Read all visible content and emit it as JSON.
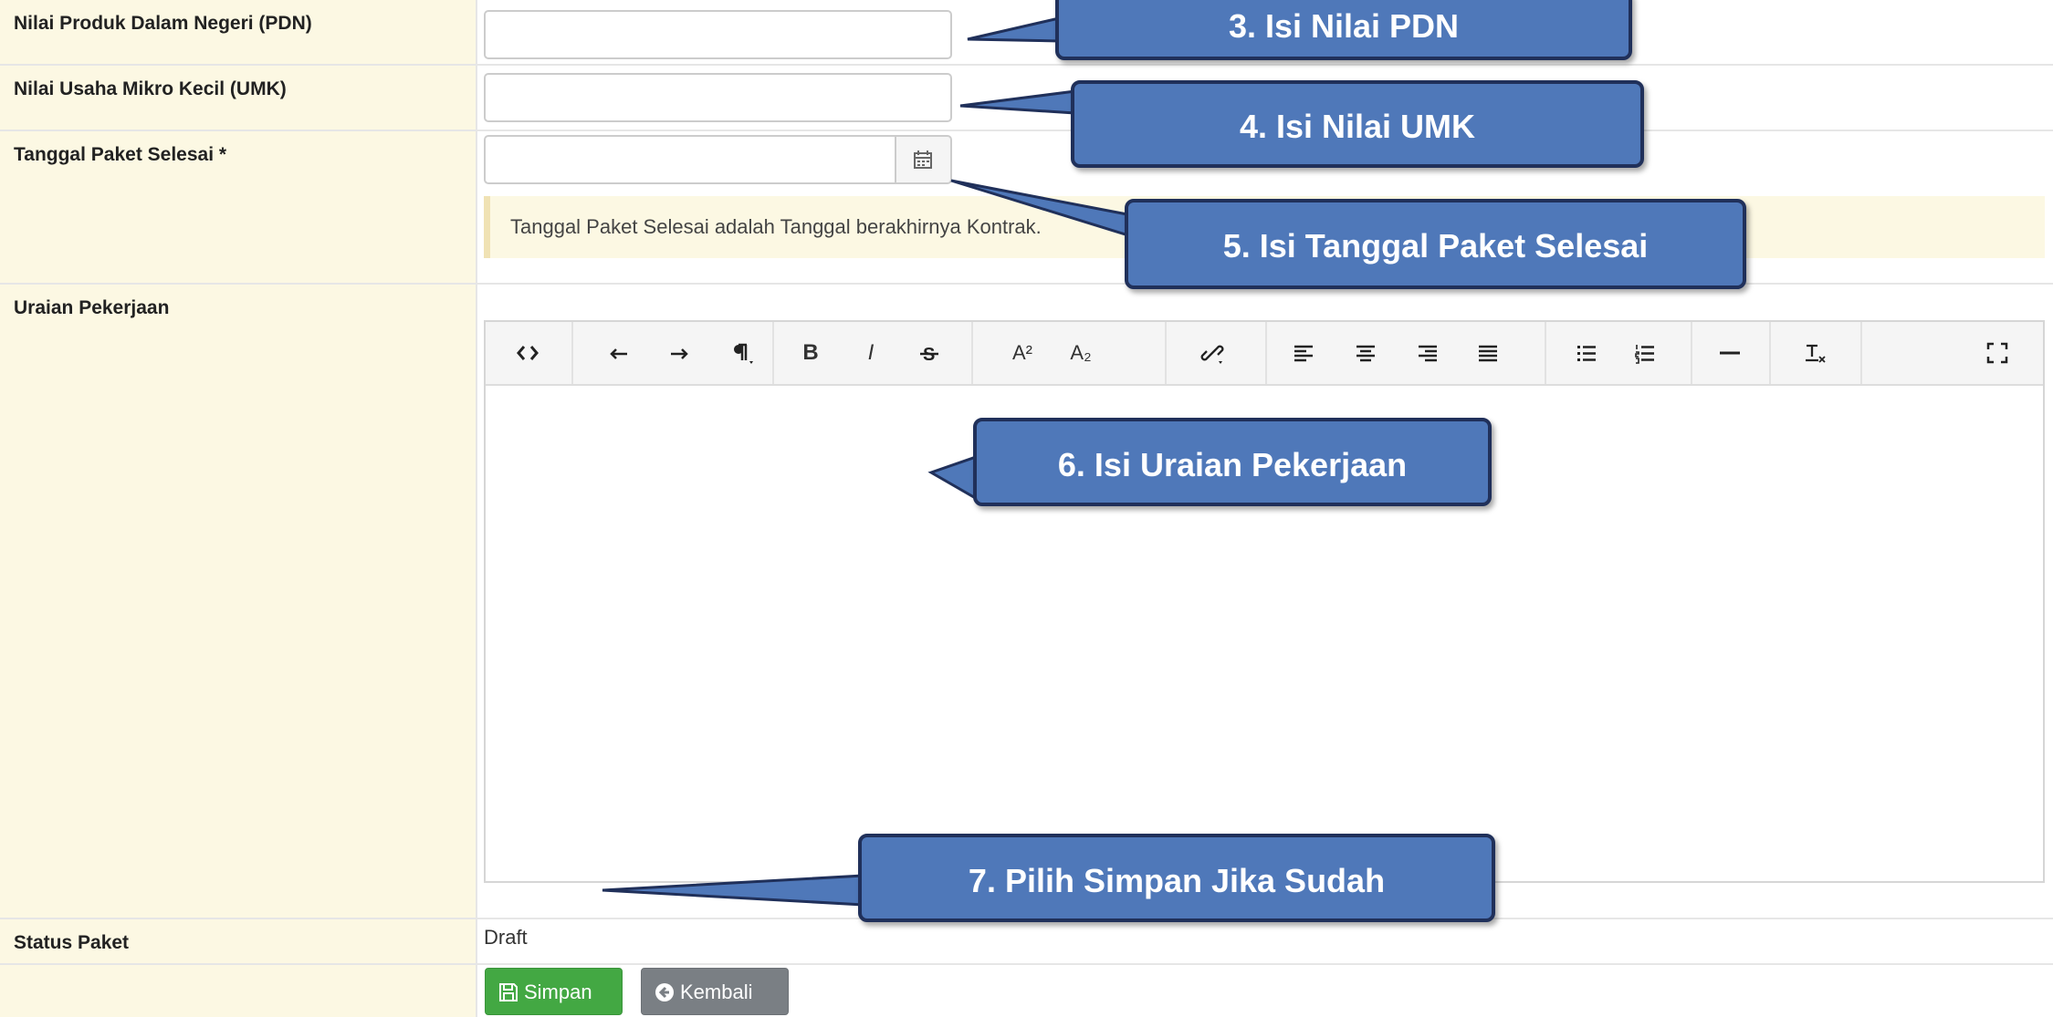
{
  "form": {
    "pdn_label": "Nilai Produk Dalam Negeri (PDN)",
    "umk_label": "Nilai Usaha Mikro Kecil (UMK)",
    "tanggal_label": "Tanggal Paket Selesai",
    "required_mark": "*",
    "tanggal_hint": "Tanggal Paket Selesai adalah Tanggal berakhirnya Kontrak.",
    "uraian_label": "Uraian Pekerjaan",
    "status_label": "Status Paket",
    "status_value": "Draft",
    "save_label": "Simpan",
    "back_label": "Kembali"
  },
  "editor": {
    "toolbar": [
      "code-view-icon",
      "undo-icon",
      "redo-icon",
      "paragraph-format-icon",
      "bold-icon",
      "italic-icon",
      "strikethrough-icon",
      "superscript-icon",
      "subscript-icon",
      "insert-link-icon",
      "align-left-icon",
      "align-center-icon",
      "align-right-icon",
      "align-justify-icon",
      "unordered-list-icon",
      "ordered-list-icon",
      "horizontal-rule-icon",
      "clear-formatting-icon",
      "fullscreen-icon"
    ],
    "bold_glyph": "B",
    "italic_glyph": "I",
    "superscript_glyph": "A²",
    "subscript_glyph": "A₂"
  },
  "callouts": {
    "c3": "3. Isi Nilai PDN",
    "c4": "4. Isi Nilai UMK",
    "c5": "5. Isi Tanggal Paket Selesai",
    "c6": "6. Isi Uraian Pekerjaan",
    "c7": "7. Pilih Simpan Jika Sudah"
  },
  "colors": {
    "label_bg": "#fcf8e3",
    "callout_bg": "#4f78b9",
    "save_button": "#43a843",
    "back_button": "#7a7f84",
    "required": "#d9534f"
  }
}
